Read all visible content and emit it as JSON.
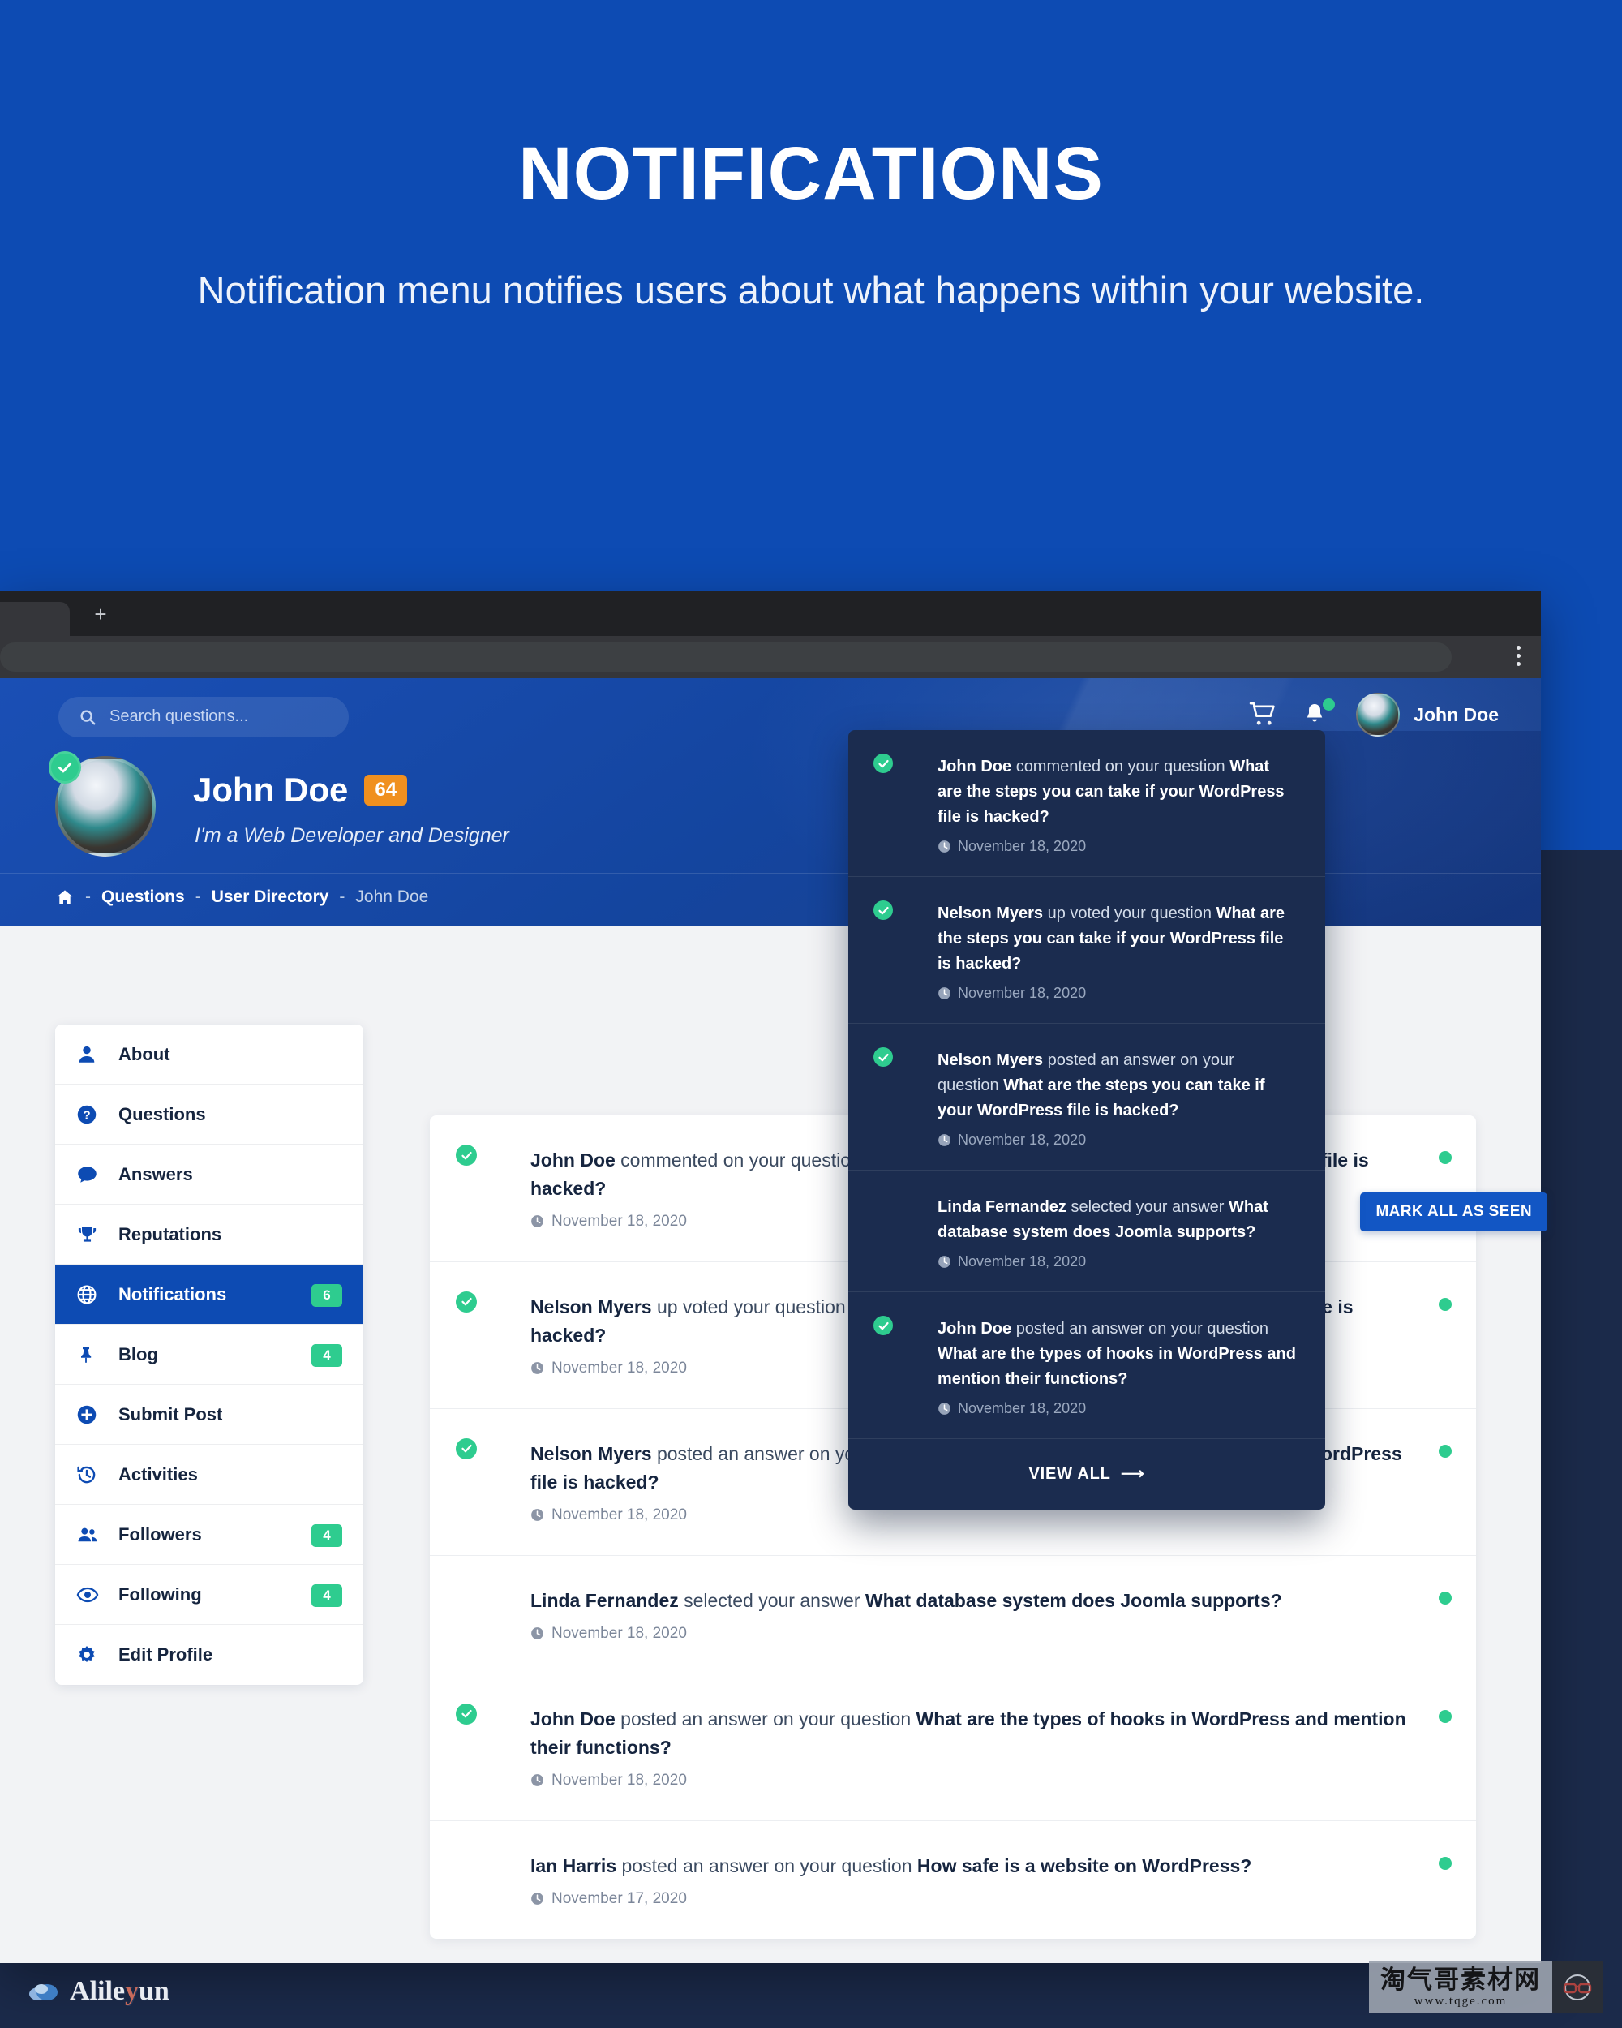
{
  "hero": {
    "title": "NOTIFICATIONS",
    "subtitle": "Notification menu notifies users about what happens within your website."
  },
  "browser": {
    "new_tab_label": "+",
    "menu_icon": "kebab-menu-icon"
  },
  "site_header": {
    "search": {
      "placeholder": "Search questions...",
      "value": ""
    },
    "cart_icon": "shopping-cart-icon",
    "bell_icon": "bell-icon",
    "user_name": "John Doe"
  },
  "profile": {
    "name": "John Doe",
    "reputation_badge": "64",
    "bio": "I'm a Web Developer and Designer"
  },
  "breadcrumb": {
    "home_icon": "home-icon",
    "sep": "-",
    "items": [
      "Questions",
      "User Directory"
    ],
    "current": "John Doe"
  },
  "sidebar": {
    "items": [
      {
        "label": "About",
        "icon": "user-icon",
        "count": "",
        "active": false
      },
      {
        "label": "Questions",
        "icon": "question-icon",
        "count": "",
        "active": false
      },
      {
        "label": "Answers",
        "icon": "comment-icon",
        "count": "",
        "active": false
      },
      {
        "label": "Reputations",
        "icon": "trophy-icon",
        "count": "",
        "active": false
      },
      {
        "label": "Notifications",
        "icon": "globe-icon",
        "count": "6",
        "active": true
      },
      {
        "label": "Blog",
        "icon": "pin-icon",
        "count": "4",
        "active": false
      },
      {
        "label": "Submit Post",
        "icon": "plus-circle-icon",
        "count": "",
        "active": false
      },
      {
        "label": "Activities",
        "icon": "history-icon",
        "count": "",
        "active": false
      },
      {
        "label": "Followers",
        "icon": "users-icon",
        "count": "4",
        "active": false
      },
      {
        "label": "Following",
        "icon": "eye-icon",
        "count": "4",
        "active": false
      },
      {
        "label": "Edit Profile",
        "icon": "gear-icon",
        "count": "",
        "active": false
      }
    ]
  },
  "main": {
    "mark_all_label": "MARK ALL AS SEEN",
    "notifications": [
      {
        "actor": "John Doe",
        "action": "commented on your question",
        "subject": "What are the steps you can take if your WordPress file is hacked?",
        "date": "November 18, 2020",
        "avatar": "av-john",
        "verified": true,
        "unseen": true
      },
      {
        "actor": "Nelson Myers",
        "action": "up voted your question",
        "subject": "What are the steps you can take if your WordPress file is hacked?",
        "date": "November 18, 2020",
        "avatar": "av-nelson",
        "verified": true,
        "unseen": true
      },
      {
        "actor": "Nelson Myers",
        "action": "posted an answer on your question",
        "subject": "What are the steps you can take if your WordPress file is hacked?",
        "date": "November 18, 2020",
        "avatar": "av-nelson",
        "verified": true,
        "unseen": true
      },
      {
        "actor": "Linda Fernandez",
        "action": "selected your answer",
        "subject": "What database system does Joomla supports?",
        "date": "November 18, 2020",
        "avatar": "av-linda",
        "verified": false,
        "unseen": true
      },
      {
        "actor": "John Doe",
        "action": "posted an answer on your question",
        "subject": "What are the types of hooks in WordPress and mention their functions?",
        "date": "November 18, 2020",
        "avatar": "av-john",
        "verified": true,
        "unseen": true
      },
      {
        "actor": "Ian Harris",
        "action": "posted an answer on your question",
        "subject": "How safe is a website on WordPress?",
        "date": "November 17, 2020",
        "avatar": "av-ian",
        "verified": false,
        "unseen": true
      }
    ]
  },
  "dropdown": {
    "view_all_label": "VIEW ALL",
    "view_all_icon": "arrow-right-icon",
    "items": [
      {
        "actor": "John Doe",
        "action": "commented on your question",
        "subject": "What are the steps you can take if your WordPress file is hacked?",
        "date": "November 18, 2020",
        "avatar": "av-john",
        "verified": true
      },
      {
        "actor": "Nelson Myers",
        "action": "up voted your question",
        "subject": "What are the steps you can take if your WordPress file is hacked?",
        "date": "November 18, 2020",
        "avatar": "av-nelson",
        "verified": true
      },
      {
        "actor": "Nelson Myers",
        "action": "posted an answer on your question",
        "subject": "What are the steps you can take if your WordPress file is hacked?",
        "date": "November 18, 2020",
        "avatar": "av-nelson",
        "verified": true
      },
      {
        "actor": "Linda Fernandez",
        "action": "selected your answer",
        "subject": "What database system does Joomla supports?",
        "date": "November 18, 2020",
        "avatar": "av-linda",
        "verified": false
      },
      {
        "actor": "John Doe",
        "action": "posted an answer on your question",
        "subject": "What are the types of hooks in WordPress and mention their functions?",
        "date": "November 18, 2020",
        "avatar": "av-john",
        "verified": true
      }
    ]
  },
  "watermarks": {
    "left": {
      "text_a": "Alile",
      "text_b": "y",
      "text_c": "un"
    },
    "right": {
      "chinese": "淘气哥素材网",
      "url": "www.tqge.com"
    }
  },
  "colors": {
    "brand_blue": "#0d4bb3",
    "dark_navy": "#1b2a4a",
    "dropdown_bg": "#1b2c4f",
    "green": "#2ecc8f",
    "orange": "#f0901f"
  }
}
